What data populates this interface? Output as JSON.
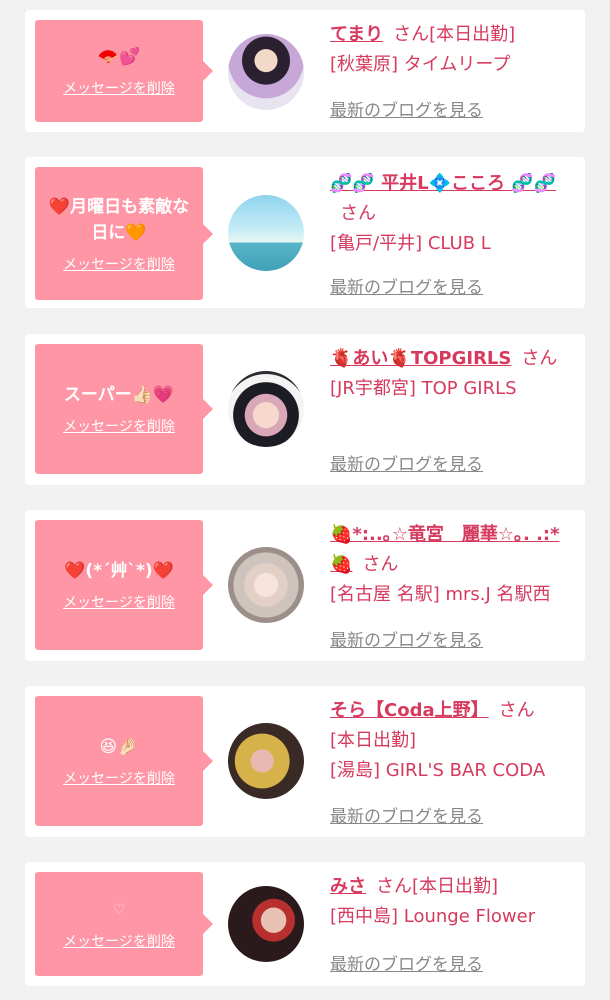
{
  "ui": {
    "delete_label": "メッセージを削除",
    "blog_label": "最新のブログを見る",
    "honorific": "さん"
  },
  "colors": {
    "bubble": "#ff96a5",
    "accent_text": "#d63a5e",
    "link_gray": "#888888",
    "background": "#f1f1f1",
    "card": "#ffffff"
  },
  "messages": [
    {
      "message": "🪭💕",
      "name": "てまり",
      "status": "[本日出勤]",
      "shop": "[秋葉原] タイムリープ",
      "avatar": "avatar-photo-temari"
    },
    {
      "message": "❤️月曜日も素敵な\n日に🧡",
      "name": "🧬🧬 平井L💠こころ 🧬🧬",
      "status": "",
      "shop": "[亀戸/平井] CLUB L",
      "avatar": "avatar-photo-kokoro"
    },
    {
      "message": "スーパー👍🏻💗",
      "name": "🫀あい🫀TOPGIRLS",
      "status": "",
      "shop": "[JR宇都宮] TOP GIRLS",
      "avatar": "avatar-photo-ai"
    },
    {
      "message": "❤️(*´艸`*)❤️",
      "name": "🍓*:..｡☆竜宮　麗華☆｡. .:*🍓",
      "status": "",
      "shop": "[名古屋 名駅] mrs.J 名駅西",
      "avatar": "avatar-photo-reika"
    },
    {
      "message": "😆🤌🏻",
      "name": "そら【Coda上野】",
      "status": "[本日出勤]",
      "shop": "[湯島] GIRL'S BAR CODA",
      "avatar": "avatar-photo-sora"
    },
    {
      "message": "♡",
      "name": "みさ",
      "status": "[本日出勤]",
      "shop": "[西中島] Lounge Flower",
      "avatar": "avatar-photo-misa"
    }
  ]
}
